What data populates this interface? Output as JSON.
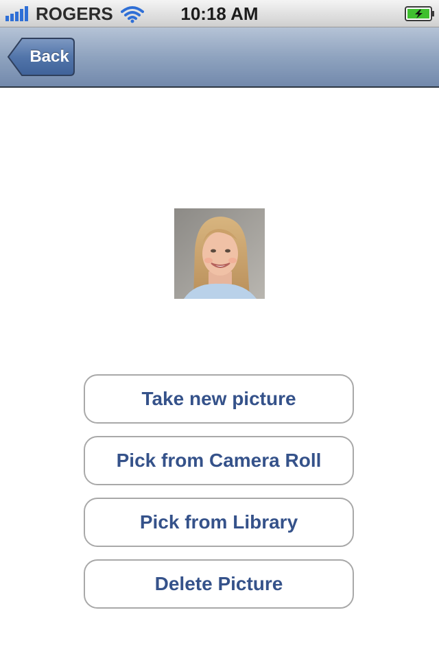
{
  "status_bar": {
    "carrier": "ROGERS",
    "time": "10:18 AM",
    "icons": [
      "signal-icon",
      "wifi-icon",
      "battery-charging-icon"
    ]
  },
  "nav_bar": {
    "back_label": "Back"
  },
  "photo": {
    "subject": "profile-picture"
  },
  "actions": [
    {
      "label": "Take new picture"
    },
    {
      "label": "Pick from Camera Roll"
    },
    {
      "label": "Pick from Library"
    },
    {
      "label": "Delete Picture"
    }
  ],
  "colors": {
    "nav_bar": "#8fa3bf",
    "button_text": "#35528a",
    "button_border": "#a8a8a8",
    "battery": "#3fbf2f"
  }
}
